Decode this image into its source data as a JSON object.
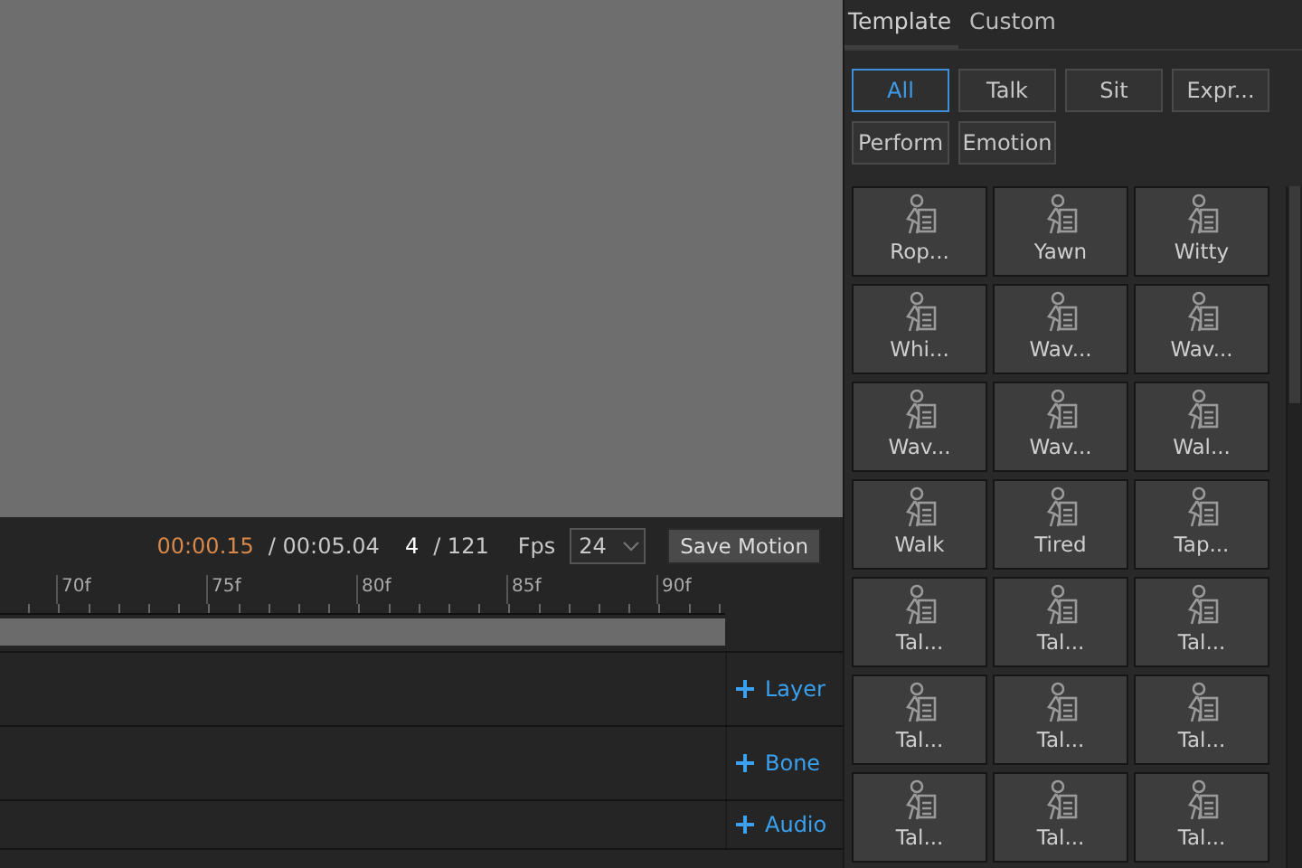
{
  "playback": {
    "current_time": "00:00.15",
    "total_time": "/ 00:05.04",
    "frame": "4",
    "frame_total": "/ 121",
    "fps_label": "Fps",
    "fps_value": "24",
    "save_button": "Save Motion"
  },
  "ruler": {
    "labels": [
      "70f",
      "75f",
      "80f",
      "85f",
      "90f"
    ]
  },
  "tracks": [
    {
      "add_label": "Layer"
    },
    {
      "add_label": "Bone"
    },
    {
      "add_label": "Audio"
    }
  ],
  "tabs": [
    {
      "label": "Template",
      "selected": true
    },
    {
      "label": "Custom",
      "selected": false
    }
  ],
  "filters": [
    {
      "label": "All",
      "selected": true
    },
    {
      "label": "Talk",
      "selected": false
    },
    {
      "label": "Sit",
      "selected": false
    },
    {
      "label": "Expr...",
      "selected": false
    },
    {
      "label": "Perform",
      "selected": false
    },
    {
      "label": "Emotion",
      "selected": false
    }
  ],
  "motions": [
    {
      "label": "Rop..."
    },
    {
      "label": "Yawn"
    },
    {
      "label": "Witty"
    },
    {
      "label": "Whi..."
    },
    {
      "label": "Wav..."
    },
    {
      "label": "Wav..."
    },
    {
      "label": "Wav..."
    },
    {
      "label": "Wav..."
    },
    {
      "label": "Wal..."
    },
    {
      "label": "Walk"
    },
    {
      "label": "Tired"
    },
    {
      "label": "Tap..."
    },
    {
      "label": "Tal..."
    },
    {
      "label": "Tal..."
    },
    {
      "label": "Tal..."
    },
    {
      "label": "Tal..."
    },
    {
      "label": "Tal..."
    },
    {
      "label": "Tal..."
    },
    {
      "label": "Tal..."
    },
    {
      "label": "Tal..."
    },
    {
      "label": "Tal..."
    }
  ]
}
